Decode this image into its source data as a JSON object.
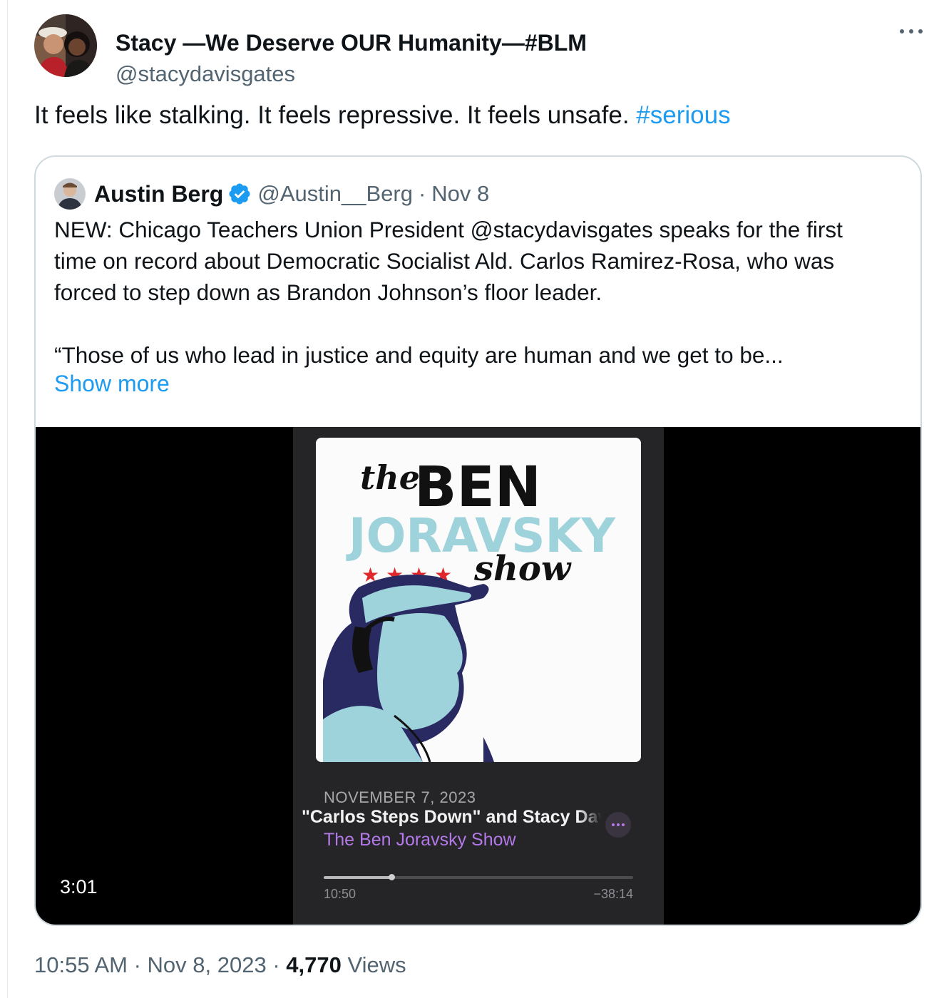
{
  "author": {
    "name": "Stacy —We Deserve OUR Humanity—#BLM",
    "handle": "@stacydavisgates",
    "avatar_icon": "profile-photo"
  },
  "tweet": {
    "text": "It feels like stalking. It feels repressive. It feels unsafe. ",
    "hashtag": "#serious"
  },
  "quoted": {
    "name": "Austin Berg",
    "handle": "@Austin__Berg",
    "separator": "·",
    "date": "Nov 8",
    "verified_icon": "verified-badge-icon",
    "lines": [
      "NEW: Chicago Teachers Union President @stacydavisgates speaks for the first",
      "time on record about Democratic Socialist Ald. Carlos Ramirez-Rosa, who was",
      "forced to step down as Brandon Johnson’s floor leader.",
      "“Those of us who lead in justice and equity are human and we get to be..."
    ],
    "show_more": "Show more"
  },
  "video": {
    "duration": "3:01",
    "player": {
      "art": {
        "word_the": "the",
        "word_ben": "BEN",
        "word_joravsky": "JORAVSKY",
        "word_show": "show"
      },
      "episode_date": "NOVEMBER 7, 2023",
      "episode_title": "\"Carlos Steps Down\" and Stacy Davis Gates",
      "show_name": "The Ben Joravsky Show",
      "progress_fraction": 0.22,
      "elapsed": "10:50",
      "remaining": "−38:14"
    }
  },
  "footer": {
    "time": "10:55 AM",
    "sep1": " · ",
    "date": "Nov 8, 2023",
    "sep2": " · ",
    "views_count": "4,770",
    "views_label": " Views"
  },
  "colors": {
    "link": "#1d9bf0",
    "secondary_text": "#536471",
    "show_purple": "#b479e8",
    "art_light_blue": "#9fd3dc",
    "art_navy": "#2a2a63",
    "art_star_red": "#e0282c"
  }
}
